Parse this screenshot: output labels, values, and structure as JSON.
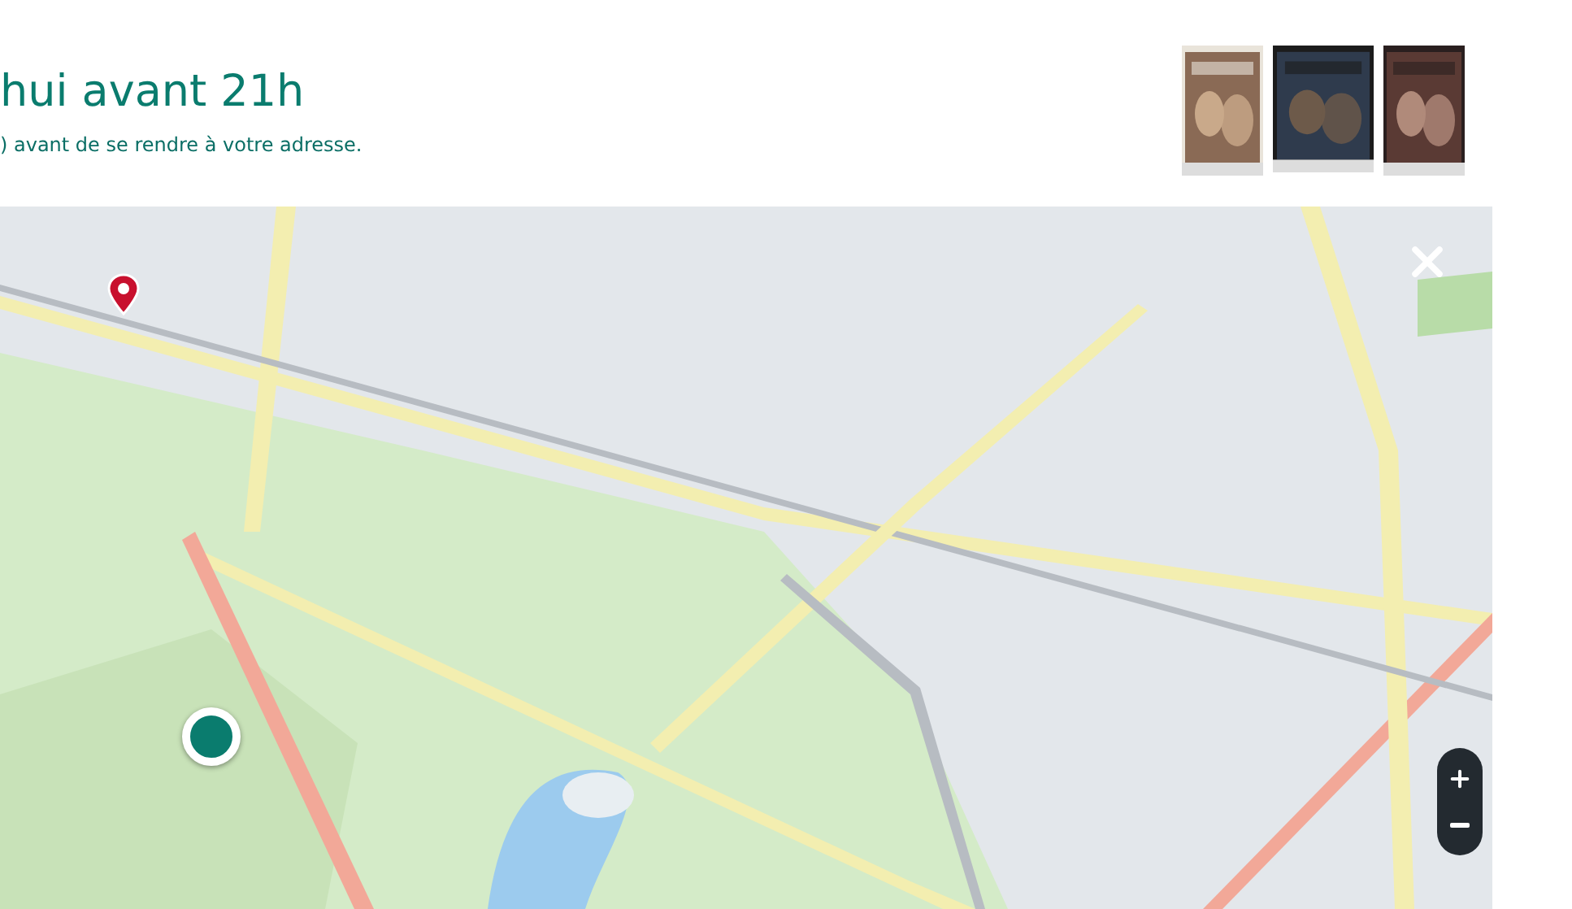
{
  "heading": "hui avant 21h",
  "subtitle": ") avant de se rendre à votre adresse."
}
